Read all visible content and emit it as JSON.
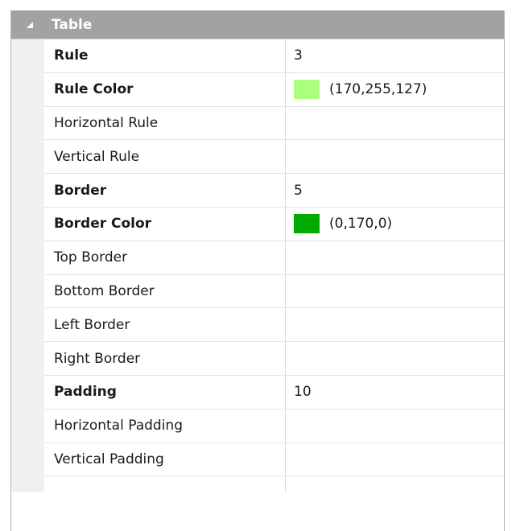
{
  "category": {
    "label": "Table",
    "expander_icon": "collapse-triangle-icon"
  },
  "properties": [
    {
      "name": "Rule",
      "value": "3",
      "bold": true
    },
    {
      "name": "Rule Color",
      "value": "(170,255,127)",
      "bold": true,
      "swatch": "#aaff7f"
    },
    {
      "name": "Horizontal Rule",
      "value": "",
      "bold": false
    },
    {
      "name": "Vertical Rule",
      "value": "",
      "bold": false
    },
    {
      "name": "Border",
      "value": "5",
      "bold": true
    },
    {
      "name": "Border Color",
      "value": "(0,170,0)",
      "bold": true,
      "swatch": "#00aa00"
    },
    {
      "name": "Top Border",
      "value": "",
      "bold": false
    },
    {
      "name": "Bottom Border",
      "value": "",
      "bold": false
    },
    {
      "name": "Left Border",
      "value": "",
      "bold": false
    },
    {
      "name": "Right Border",
      "value": "",
      "bold": false
    },
    {
      "name": "Padding",
      "value": "10",
      "bold": true
    },
    {
      "name": "Horizontal Padding",
      "value": "",
      "bold": false
    },
    {
      "name": "Vertical Padding",
      "value": "",
      "bold": false
    }
  ],
  "colors": {
    "category_bg": "#a2a2a2",
    "gutter_bg": "#f0f0f0",
    "grid_line": "#e4e4e4"
  }
}
